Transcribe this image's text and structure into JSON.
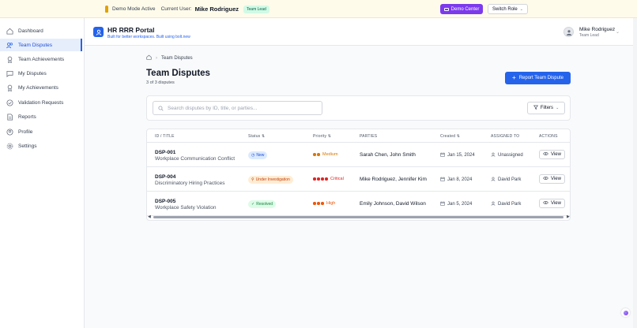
{
  "demo_bar": {
    "mode_label": "Demo Mode Active",
    "current_user_label": "Current User:",
    "user_name": "Mike Rodriguez",
    "role_badge": "Team Lead",
    "demo_center_label": "Demo Center",
    "switch_role_label": "Switch Role"
  },
  "sidebar": {
    "items": [
      {
        "label": "Dashboard",
        "icon": "home-icon"
      },
      {
        "label": "Team Disputes",
        "icon": "users-icon",
        "active": true
      },
      {
        "label": "Team Achievements",
        "icon": "award-icon"
      },
      {
        "label": "My Disputes",
        "icon": "message-icon"
      },
      {
        "label": "My Achievements",
        "icon": "award-icon"
      },
      {
        "label": "Validation Requests",
        "icon": "check-circle-icon"
      },
      {
        "label": "Reports",
        "icon": "file-icon"
      },
      {
        "label": "Profile",
        "icon": "user-icon"
      },
      {
        "label": "Settings",
        "icon": "gear-icon"
      }
    ]
  },
  "header": {
    "app_title": "HR RRR Portal",
    "app_subtitle": "Built for better workspaces. Built using bolt.new",
    "user_name": "Mike Rodriguez",
    "user_role": "Team Lead"
  },
  "breadcrumb": {
    "current": "Team Disputes"
  },
  "page": {
    "title": "Team Disputes",
    "count_text": "3 of 3 disputes",
    "report_button": "Report Team Dispute"
  },
  "search": {
    "placeholder": "Search disputes by ID, title, or parties...",
    "value": ""
  },
  "filters_label": "Filters",
  "table": {
    "headers": {
      "id_title": "ID / TITLE",
      "status": "Status",
      "priority": "Priority",
      "parties": "PARTIES",
      "created": "Created",
      "assigned": "ASSIGNED TO",
      "actions": "ACTIONS"
    },
    "rows": [
      {
        "id": "DSP-001",
        "title": "Workplace Communication Conflict",
        "status": "New",
        "priority": "Medium",
        "priority_level": 2,
        "parties": "Sarah Chen, John Smith",
        "created": "Jan 15, 2024",
        "assigned": "Unassigned",
        "action": "View"
      },
      {
        "id": "DSP-004",
        "title": "Discriminatory Hiring Practices",
        "status": "Under Investigation",
        "priority": "Critical",
        "priority_level": 4,
        "parties": "Mike Rodriguez, Jennifer Kim",
        "created": "Jan 8, 2024",
        "assigned": "David Park",
        "action": "View"
      },
      {
        "id": "DSP-005",
        "title": "Workplace Safety Violation",
        "status": "Resolved",
        "priority": "High",
        "priority_level": 3,
        "parties": "Emily Johnson, David Wilson",
        "created": "Jan 5, 2024",
        "assigned": "David Park",
        "action": "View"
      }
    ]
  },
  "colors": {
    "accent": "#2563eb",
    "demo_purple": "#7c3aed",
    "status_new_bg": "#dbeafe",
    "status_new_fg": "#1d4ed8",
    "status_investigation_bg": "#ffedd5",
    "status_investigation_fg": "#c2410c",
    "status_resolved_bg": "#dcfce7",
    "status_resolved_fg": "#15803d",
    "priority_medium": "#d97706",
    "priority_critical": "#dc2626",
    "priority_high": "#ea580c"
  }
}
